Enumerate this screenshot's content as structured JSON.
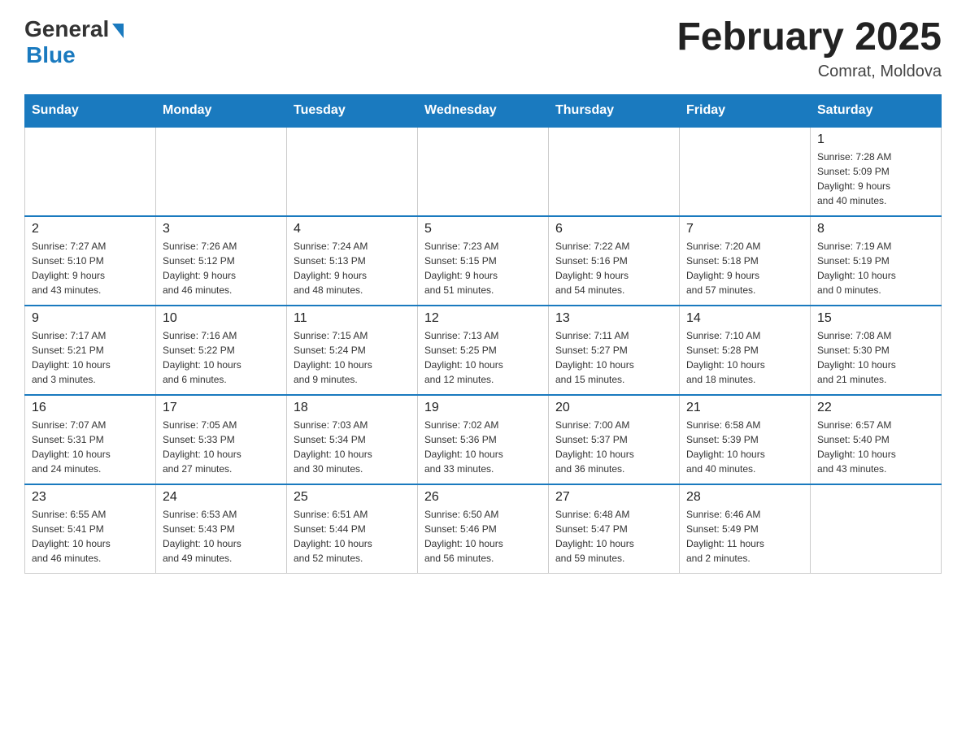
{
  "header": {
    "logo_general": "General",
    "logo_blue": "Blue",
    "title": "February 2025",
    "location": "Comrat, Moldova"
  },
  "weekdays": [
    "Sunday",
    "Monday",
    "Tuesday",
    "Wednesday",
    "Thursday",
    "Friday",
    "Saturday"
  ],
  "weeks": [
    [
      {
        "day": "",
        "info": ""
      },
      {
        "day": "",
        "info": ""
      },
      {
        "day": "",
        "info": ""
      },
      {
        "day": "",
        "info": ""
      },
      {
        "day": "",
        "info": ""
      },
      {
        "day": "",
        "info": ""
      },
      {
        "day": "1",
        "info": "Sunrise: 7:28 AM\nSunset: 5:09 PM\nDaylight: 9 hours\nand 40 minutes."
      }
    ],
    [
      {
        "day": "2",
        "info": "Sunrise: 7:27 AM\nSunset: 5:10 PM\nDaylight: 9 hours\nand 43 minutes."
      },
      {
        "day": "3",
        "info": "Sunrise: 7:26 AM\nSunset: 5:12 PM\nDaylight: 9 hours\nand 46 minutes."
      },
      {
        "day": "4",
        "info": "Sunrise: 7:24 AM\nSunset: 5:13 PM\nDaylight: 9 hours\nand 48 minutes."
      },
      {
        "day": "5",
        "info": "Sunrise: 7:23 AM\nSunset: 5:15 PM\nDaylight: 9 hours\nand 51 minutes."
      },
      {
        "day": "6",
        "info": "Sunrise: 7:22 AM\nSunset: 5:16 PM\nDaylight: 9 hours\nand 54 minutes."
      },
      {
        "day": "7",
        "info": "Sunrise: 7:20 AM\nSunset: 5:18 PM\nDaylight: 9 hours\nand 57 minutes."
      },
      {
        "day": "8",
        "info": "Sunrise: 7:19 AM\nSunset: 5:19 PM\nDaylight: 10 hours\nand 0 minutes."
      }
    ],
    [
      {
        "day": "9",
        "info": "Sunrise: 7:17 AM\nSunset: 5:21 PM\nDaylight: 10 hours\nand 3 minutes."
      },
      {
        "day": "10",
        "info": "Sunrise: 7:16 AM\nSunset: 5:22 PM\nDaylight: 10 hours\nand 6 minutes."
      },
      {
        "day": "11",
        "info": "Sunrise: 7:15 AM\nSunset: 5:24 PM\nDaylight: 10 hours\nand 9 minutes."
      },
      {
        "day": "12",
        "info": "Sunrise: 7:13 AM\nSunset: 5:25 PM\nDaylight: 10 hours\nand 12 minutes."
      },
      {
        "day": "13",
        "info": "Sunrise: 7:11 AM\nSunset: 5:27 PM\nDaylight: 10 hours\nand 15 minutes."
      },
      {
        "day": "14",
        "info": "Sunrise: 7:10 AM\nSunset: 5:28 PM\nDaylight: 10 hours\nand 18 minutes."
      },
      {
        "day": "15",
        "info": "Sunrise: 7:08 AM\nSunset: 5:30 PM\nDaylight: 10 hours\nand 21 minutes."
      }
    ],
    [
      {
        "day": "16",
        "info": "Sunrise: 7:07 AM\nSunset: 5:31 PM\nDaylight: 10 hours\nand 24 minutes."
      },
      {
        "day": "17",
        "info": "Sunrise: 7:05 AM\nSunset: 5:33 PM\nDaylight: 10 hours\nand 27 minutes."
      },
      {
        "day": "18",
        "info": "Sunrise: 7:03 AM\nSunset: 5:34 PM\nDaylight: 10 hours\nand 30 minutes."
      },
      {
        "day": "19",
        "info": "Sunrise: 7:02 AM\nSunset: 5:36 PM\nDaylight: 10 hours\nand 33 minutes."
      },
      {
        "day": "20",
        "info": "Sunrise: 7:00 AM\nSunset: 5:37 PM\nDaylight: 10 hours\nand 36 minutes."
      },
      {
        "day": "21",
        "info": "Sunrise: 6:58 AM\nSunset: 5:39 PM\nDaylight: 10 hours\nand 40 minutes."
      },
      {
        "day": "22",
        "info": "Sunrise: 6:57 AM\nSunset: 5:40 PM\nDaylight: 10 hours\nand 43 minutes."
      }
    ],
    [
      {
        "day": "23",
        "info": "Sunrise: 6:55 AM\nSunset: 5:41 PM\nDaylight: 10 hours\nand 46 minutes."
      },
      {
        "day": "24",
        "info": "Sunrise: 6:53 AM\nSunset: 5:43 PM\nDaylight: 10 hours\nand 49 minutes."
      },
      {
        "day": "25",
        "info": "Sunrise: 6:51 AM\nSunset: 5:44 PM\nDaylight: 10 hours\nand 52 minutes."
      },
      {
        "day": "26",
        "info": "Sunrise: 6:50 AM\nSunset: 5:46 PM\nDaylight: 10 hours\nand 56 minutes."
      },
      {
        "day": "27",
        "info": "Sunrise: 6:48 AM\nSunset: 5:47 PM\nDaylight: 10 hours\nand 59 minutes."
      },
      {
        "day": "28",
        "info": "Sunrise: 6:46 AM\nSunset: 5:49 PM\nDaylight: 11 hours\nand 2 minutes."
      },
      {
        "day": "",
        "info": ""
      }
    ]
  ]
}
